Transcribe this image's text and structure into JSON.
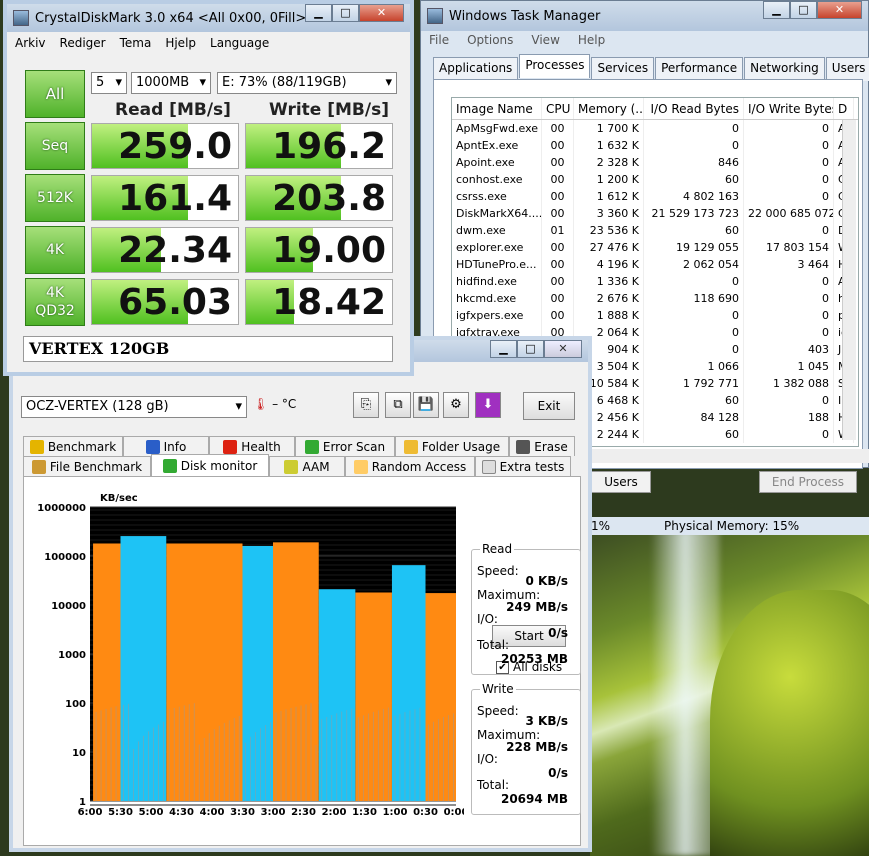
{
  "cdm": {
    "title": "CrystalDiskMark 3.0 x64 <All 0x00, 0Fill>",
    "menu": [
      "Arkiv",
      "Rediger",
      "Tema",
      "Hjelp",
      "Language"
    ],
    "count": "5",
    "size": "1000MB",
    "drive": "E: 73% (88/119GB)",
    "all_label": "All",
    "read_header": "Read [MB/s]",
    "write_header": "Write [MB/s]",
    "rows": [
      {
        "label": "Seq",
        "read": "259.0",
        "write": "196.2",
        "read_fill": 0.66,
        "write_fill": 0.65
      },
      {
        "label": "512K",
        "read": "161.4",
        "write": "203.8",
        "read_fill": 0.66,
        "write_fill": 0.65
      },
      {
        "label": "4K",
        "read": "22.34",
        "write": "19.00",
        "read_fill": 0.47,
        "write_fill": 0.46
      },
      {
        "label": "4K\nQD32",
        "read": "65.03",
        "write": "18.42",
        "read_fill": 0.66,
        "write_fill": 0.33
      }
    ],
    "comment": "VERTEX 120GB"
  },
  "tm": {
    "title": "Windows Task Manager",
    "menu": [
      "File",
      "Options",
      "View",
      "Help"
    ],
    "tabs": [
      "Applications",
      "Processes",
      "Services",
      "Performance",
      "Networking",
      "Users"
    ],
    "columns": [
      "Image Name",
      "CPU",
      "Memory (...",
      "I/O Read Bytes",
      "I/O Write Bytes",
      "D"
    ],
    "rows": [
      [
        "ApMsgFwd.exe",
        "00",
        "1 700 K",
        "0",
        "0",
        "A"
      ],
      [
        "ApntEx.exe",
        "00",
        "1 632 K",
        "0",
        "0",
        "A"
      ],
      [
        "Apoint.exe",
        "00",
        "2 328 K",
        "846",
        "0",
        "A"
      ],
      [
        "conhost.exe",
        "00",
        "1 200 K",
        "60",
        "0",
        "C"
      ],
      [
        "csrss.exe",
        "00",
        "1 612 K",
        "4 802 163",
        "0",
        "C"
      ],
      [
        "DiskMarkX64....",
        "00",
        "3 360 K",
        "21 529 173 723",
        "22 000 685 072",
        "C"
      ],
      [
        "dwm.exe",
        "01",
        "23 536 K",
        "60",
        "0",
        "D"
      ],
      [
        "explorer.exe",
        "00",
        "27 476 K",
        "19 129 055",
        "17 803 154",
        "W"
      ],
      [
        "HDTunePro.e...",
        "00",
        "4 196 K",
        "2 062 054",
        "3 464",
        "H"
      ],
      [
        "hidfind.exe",
        "00",
        "1 336 K",
        "0",
        "0",
        "A"
      ],
      [
        "hkcmd.exe",
        "00",
        "2 676 K",
        "118 690",
        "0",
        "h"
      ],
      [
        "igfxpers.exe",
        "00",
        "1 888 K",
        "0",
        "0",
        "p"
      ],
      [
        "igfxtray.exe",
        "00",
        "2 064 K",
        "0",
        "0",
        "ig"
      ],
      [
        "",
        "",
        "904 K",
        "0",
        "403",
        "J"
      ],
      [
        "",
        "",
        "3 504 K",
        "1 066",
        "1 045",
        "M"
      ],
      [
        "",
        "",
        "10 584 K",
        "1 792 771",
        "1 382 088",
        "S"
      ],
      [
        "",
        "",
        "6 468 K",
        "60",
        "0",
        "I"
      ],
      [
        "",
        "",
        "2 456 K",
        "84 128",
        "188",
        "H"
      ],
      [
        "",
        "",
        "2 244 K",
        "60",
        "0",
        "W"
      ]
    ],
    "users_btn": "Users",
    "end_process": "End Process",
    "status_cpu": "1%",
    "status_mem": "Physical Memory: 15%"
  },
  "hdt": {
    "drive": "OCZ-VERTEX          (128 gB)",
    "temp": "– °C",
    "exit": "Exit",
    "tabs_top": [
      "Benchmark",
      "Info",
      "Health",
      "Error Scan",
      "Folder Usage",
      "Erase"
    ],
    "tabs_bottom": [
      "File Benchmark",
      "Disk monitor",
      "AAM",
      "Random Access",
      "Extra tests"
    ],
    "start": "Start",
    "all_disks": "All disks",
    "read_title": "Read",
    "write_title": "Write",
    "labels": {
      "speed": "Speed:",
      "maximum": "Maximum:",
      "io": "I/O:",
      "total": "Total:"
    },
    "read": {
      "speed": "0 KB/s",
      "maximum": "249 MB/s",
      "io": "0/s",
      "total": "20253 MB"
    },
    "write": {
      "speed": "3 KB/s",
      "maximum": "228 MB/s",
      "io": "0/s",
      "total": "20694 MB"
    }
  },
  "chart_data": {
    "type": "bar",
    "ylabel": "KB/sec",
    "yscale": "log",
    "y_ticks": [
      "1000000",
      "100000",
      "10000",
      "1000",
      "100",
      "10",
      "1"
    ],
    "x_ticks": [
      "6:00",
      "5:30",
      "5:00",
      "4:30",
      "4:00",
      "3:30",
      "3:00",
      "2:30",
      "2:00",
      "1:30",
      "1:00",
      "0:30",
      "0:00"
    ],
    "colors": {
      "read": "#1ec3f5",
      "write": "#ff8a12"
    },
    "series": [
      {
        "name": "Read",
        "values": [
          [
            5.5,
            4.75,
            255000
          ],
          [
            3.5,
            3.0,
            160000
          ],
          [
            2.25,
            1.65,
            21000
          ],
          [
            1.05,
            0.5,
            65000
          ]
        ]
      },
      {
        "name": "Write",
        "values": [
          [
            5.95,
            5.5,
            180000
          ],
          [
            4.75,
            3.5,
            180000
          ],
          [
            3.0,
            2.25,
            190000
          ],
          [
            1.65,
            1.05,
            18000
          ],
          [
            0.5,
            0.0,
            17500
          ]
        ]
      }
    ]
  }
}
